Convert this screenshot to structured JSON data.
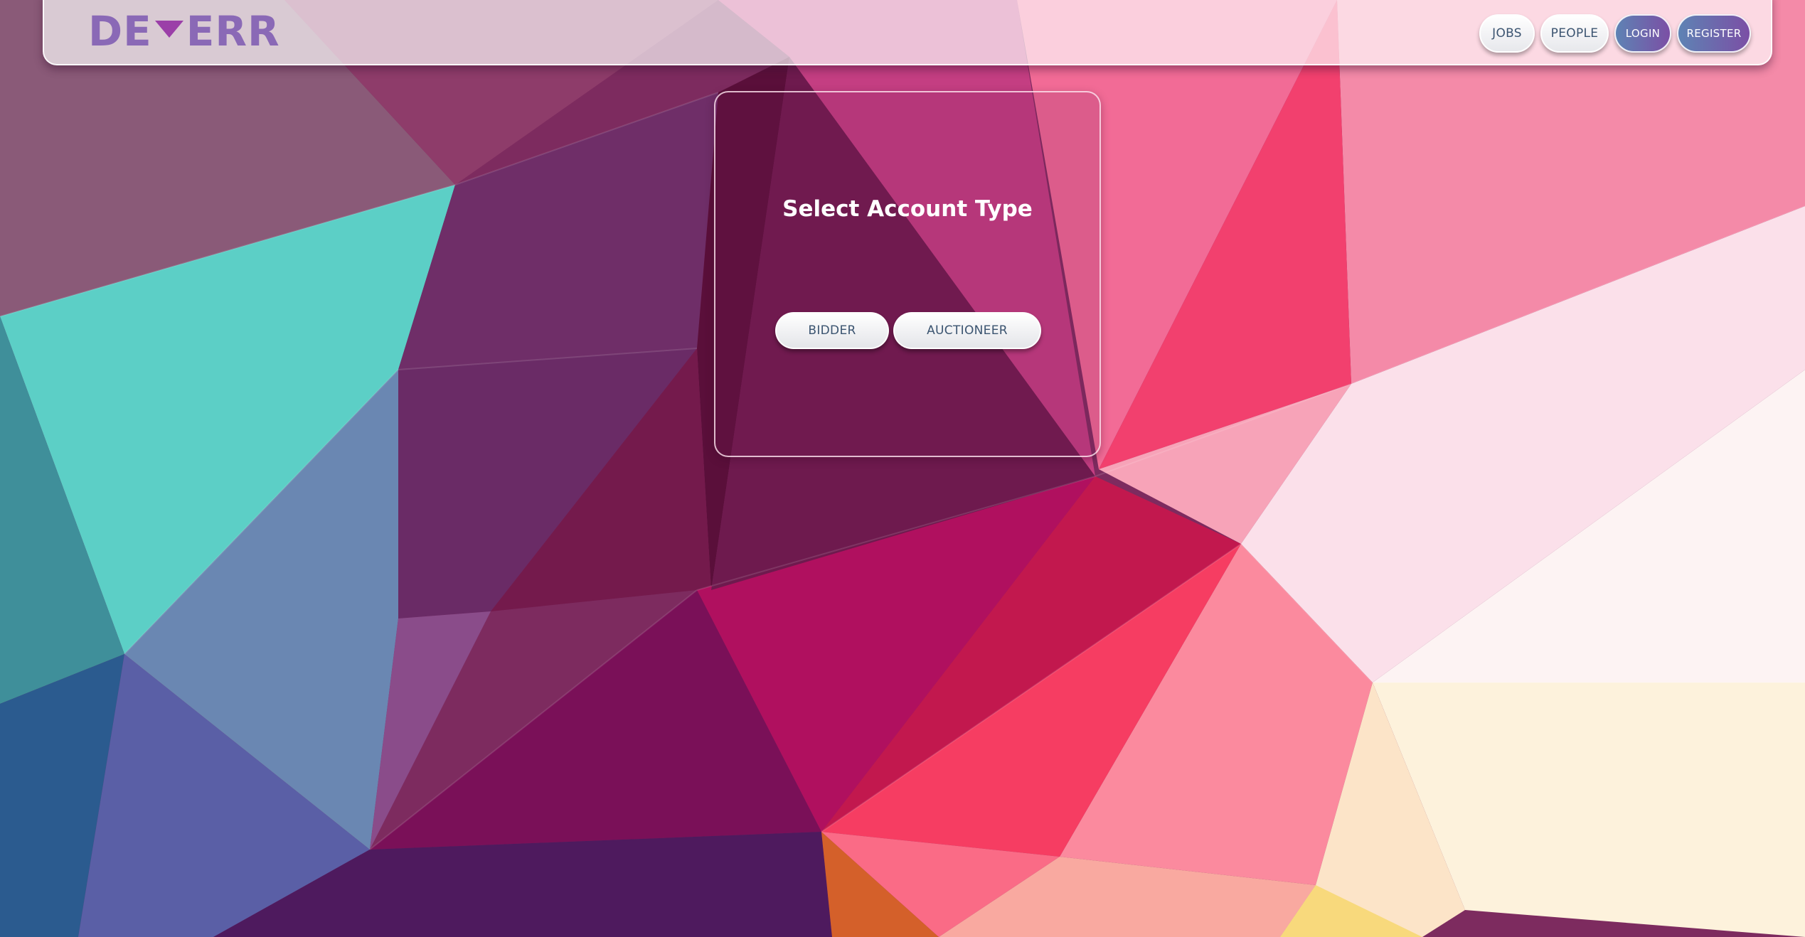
{
  "brand": {
    "logo_left": "DE",
    "logo_right": "ERR",
    "logo_icon": "triangle-down-icon"
  },
  "nav": {
    "jobs": "JOBS",
    "people": "PEOPLE",
    "login": "LOGIN",
    "register": "REGISTER"
  },
  "card": {
    "title": "Select Account Type",
    "bidder": "BIDDER",
    "auctioneer": "AUCTIONEER"
  },
  "colors": {
    "logo": "#8a69b6",
    "logo_triangle": "#9b3fa8",
    "button_text": "#3b5470",
    "accent_gradient_start": "#5e83b4",
    "accent_gradient_end": "#7b4fa5"
  }
}
